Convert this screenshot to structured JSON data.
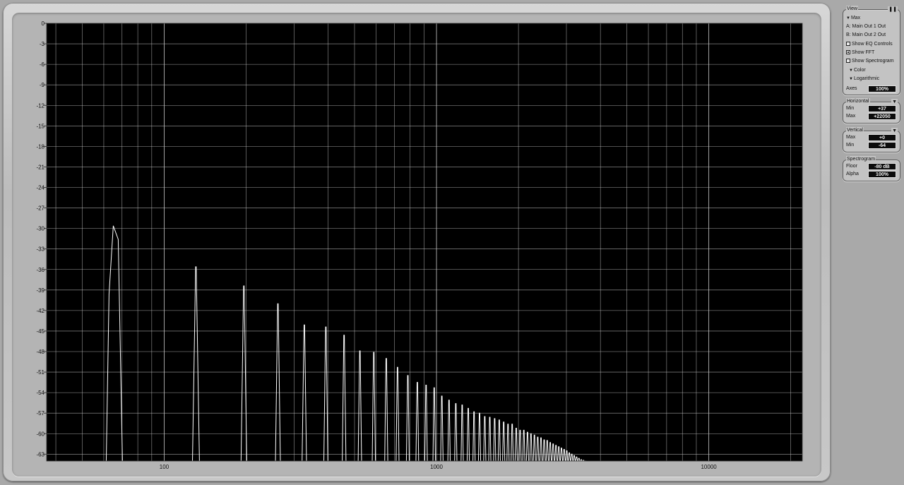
{
  "chart_data": {
    "type": "line",
    "title": "",
    "xlabel": "",
    "ylabel": "",
    "x_scale": "log",
    "xlim": [
      37,
      22050
    ],
    "ylim": [
      -64,
      0
    ],
    "grid": true,
    "y_ticks": [
      "0",
      "-3",
      "-6",
      "-9",
      "-12",
      "-15",
      "-18",
      "-21",
      "-24",
      "-27",
      "-30",
      "-33",
      "-36",
      "-39",
      "-42",
      "-45",
      "-48",
      "-51",
      "-54",
      "-57",
      "-60",
      "-63"
    ],
    "x_ticks": [
      {
        "label": "100",
        "value": 100
      },
      {
        "label": "1000",
        "value": 1000
      },
      {
        "label": "10000",
        "value": 10000
      }
    ],
    "harmonic_peaks": [
      {
        "freq": 65.4,
        "db": -29.6
      },
      {
        "freq": 130.8,
        "db": -35.6
      },
      {
        "freq": 196.2,
        "db": -38.4
      },
      {
        "freq": 261.6,
        "db": -41.0
      },
      {
        "freq": 327,
        "db": -44.1
      },
      {
        "freq": 392.4,
        "db": -44.4
      },
      {
        "freq": 457.8,
        "db": -45.6
      },
      {
        "freq": 523.2,
        "db": -47.9
      },
      {
        "freq": 588.6,
        "db": -48.1
      },
      {
        "freq": 654,
        "db": -49.0
      },
      {
        "freq": 719.4,
        "db": -50.3
      },
      {
        "freq": 784.8,
        "db": -51.5
      },
      {
        "freq": 850.2,
        "db": -52.5
      },
      {
        "freq": 915.6,
        "db": -52.9
      },
      {
        "freq": 981,
        "db": -53.3
      },
      {
        "freq": 1046.4,
        "db": -54.5
      },
      {
        "freq": 1111.8,
        "db": -55.1
      },
      {
        "freq": 1177.2,
        "db": -55.6
      },
      {
        "freq": 1242.6,
        "db": -55.8
      },
      {
        "freq": 1308,
        "db": -56.3
      },
      {
        "freq": 1373.4,
        "db": -56.8
      },
      {
        "freq": 1438.8,
        "db": -57.0
      },
      {
        "freq": 1504.2,
        "db": -57.5
      },
      {
        "freq": 1569.6,
        "db": -57.6
      },
      {
        "freq": 1635,
        "db": -57.8
      },
      {
        "freq": 1700.4,
        "db": -58.0
      },
      {
        "freq": 1765.8,
        "db": -58.3
      },
      {
        "freq": 1831.2,
        "db": -58.6
      },
      {
        "freq": 1896.6,
        "db": -58.6
      },
      {
        "freq": 1962,
        "db": -59.2
      },
      {
        "freq": 2027.4,
        "db": -59.5
      },
      {
        "freq": 2092.8,
        "db": -59.5
      },
      {
        "freq": 2158.2,
        "db": -59.8
      },
      {
        "freq": 2223.6,
        "db": -60.0
      },
      {
        "freq": 2289,
        "db": -60.2
      },
      {
        "freq": 2354.4,
        "db": -60.5
      },
      {
        "freq": 2419.8,
        "db": -60.6
      },
      {
        "freq": 2485.2,
        "db": -60.9
      },
      {
        "freq": 2550.6,
        "db": -61.0
      },
      {
        "freq": 2616,
        "db": -61.3
      },
      {
        "freq": 2681.4,
        "db": -61.5
      },
      {
        "freq": 2746.8,
        "db": -61.7
      },
      {
        "freq": 2812.2,
        "db": -61.9
      },
      {
        "freq": 2877.6,
        "db": -62.1
      },
      {
        "freq": 2943,
        "db": -62.3
      },
      {
        "freq": 3008.4,
        "db": -62.5
      },
      {
        "freq": 3073.8,
        "db": -62.8
      },
      {
        "freq": 3139.2,
        "db": -63.0
      },
      {
        "freq": 3204.6,
        "db": -63.2
      },
      {
        "freq": 3270,
        "db": -63.4
      },
      {
        "freq": 3335.4,
        "db": -63.6
      },
      {
        "freq": 3400.8,
        "db": -63.8
      },
      {
        "freq": 3466.2,
        "db": -63.9
      },
      {
        "freq": 3531.6,
        "db": -64.0
      }
    ],
    "colors": {
      "background": "#000000",
      "grid": "#c8c8c8",
      "trace": "#ffffff"
    }
  },
  "view": {
    "title": "View",
    "pause_icon": "pause-icon",
    "mode": "Max",
    "source_a": "A: Main Out 1 Out",
    "source_b": "B: Main Out 2 Out",
    "show_eq": {
      "label": "Show EQ Controls",
      "checked": false
    },
    "show_fft": {
      "label": "Show FFT",
      "checked": true
    },
    "show_spectrogram": {
      "label": "Show Spectrogram",
      "checked": false
    },
    "color": "Color",
    "scale": "Logarithmic",
    "axes_label": "Axes",
    "axes_value": "100%"
  },
  "horizontal": {
    "title": "Horizontal",
    "min_label": "Min",
    "min_value": "+37",
    "max_label": "Max",
    "max_value": "+22050"
  },
  "vertical": {
    "title": "Vertical",
    "max_label": "Max",
    "max_value": "+0",
    "min_label": "Min",
    "min_value": "-64"
  },
  "spectrogram": {
    "title": "Spectrogram",
    "floor_label": "Floor",
    "floor_value": "-80 dB",
    "alpha_label": "Alpha",
    "alpha_value": "100%"
  }
}
